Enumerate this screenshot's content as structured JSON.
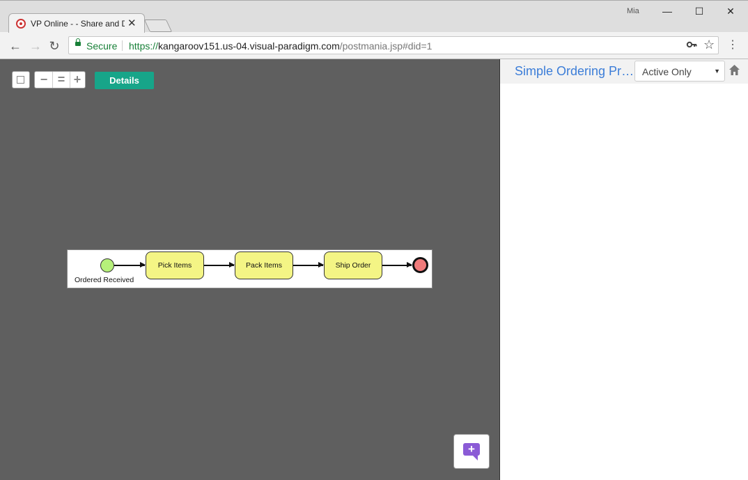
{
  "browser": {
    "tab_title": "VP Online - - Share and D",
    "tab_close": "✕",
    "user": "Mia",
    "window_controls": {
      "minimize": "—",
      "maximize": "☐",
      "close": "✕"
    },
    "nav": {
      "back": "←",
      "forward": "→",
      "reload": "↻"
    },
    "secure_label": "Secure",
    "url_scheme": "https://",
    "url_host": "kangaroov151.us-04.visual-paradigm.com",
    "url_path": "/postmania.jsp#did=1",
    "key_icon": "🔑",
    "star_icon": "☆",
    "menu_icon": "⋮"
  },
  "canvas": {
    "zoom_out": "−",
    "zoom_reset": "=",
    "zoom_in": "+",
    "details_label": "Details"
  },
  "diagram": {
    "start_label": "Ordered Received",
    "tasks": [
      "Pick Items",
      "Pack Items",
      "Ship Order"
    ],
    "colors": {
      "start": "#b6f07a",
      "task": "#f4f585",
      "end": "#f07b7b"
    }
  },
  "chat": {
    "icon": "+"
  },
  "side_panel": {
    "title": "Simple Ordering Process",
    "filter_value": "Active Only",
    "filter_caret": "▼",
    "title_color": "#3b7dd8"
  },
  "colors": {
    "accent": "#17a589",
    "canvas": "#5f5f5f"
  }
}
